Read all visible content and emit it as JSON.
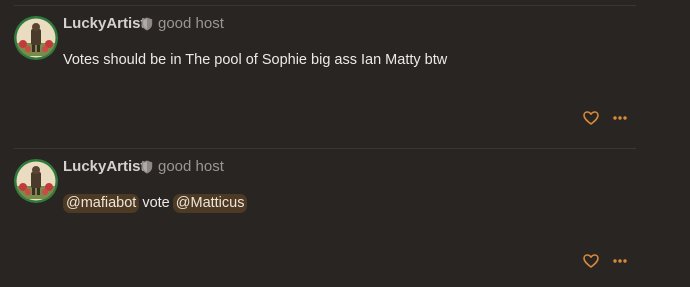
{
  "colors": {
    "background": "#282523",
    "divider": "#3b3633",
    "username": "#d4d1ce",
    "usertitle": "#9b9693",
    "body_text": "#ece9e6",
    "mention_bg": "#4d3a25",
    "action_icon": "#d88a3a"
  },
  "posts": [
    {
      "username": "LuckyArtist",
      "user_title": "good host",
      "badge_icon": "shield-icon",
      "body": "Votes should be in The pool of Sophie big ass Ian Matty btw",
      "actions": [
        "like-heart-icon",
        "more-options-icon"
      ]
    },
    {
      "username": "LuckyArtist",
      "user_title": "good host",
      "badge_icon": "shield-icon",
      "mention1": "@mafiabot",
      "body_word": "vote",
      "mention2": "@Matticus",
      "actions": [
        "like-heart-icon",
        "more-options-icon"
      ]
    }
  ]
}
